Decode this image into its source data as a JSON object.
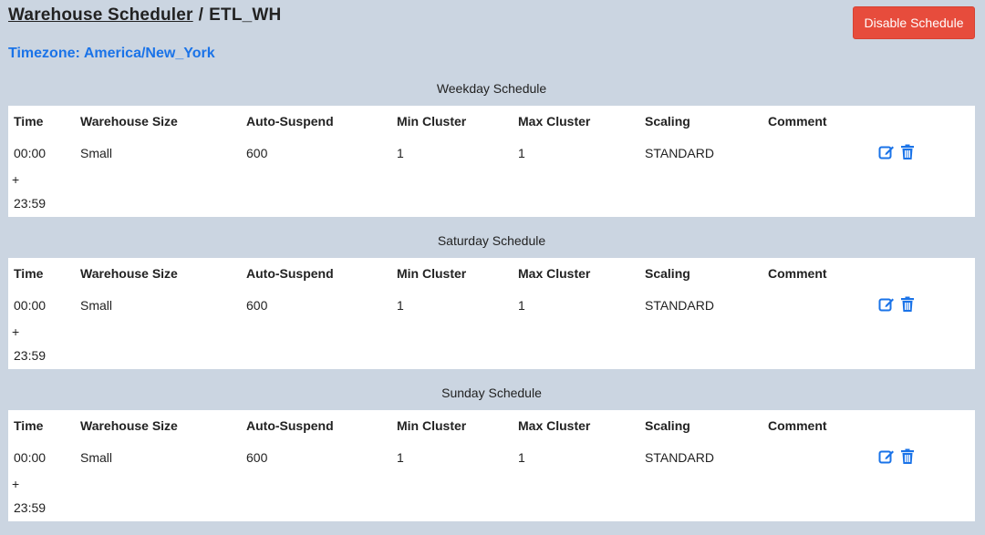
{
  "header": {
    "breadcrumb_root": "Warehouse Scheduler",
    "separator": "/",
    "current": "ETL_WH"
  },
  "actions": {
    "disable_label": "Disable Schedule"
  },
  "timezone": {
    "label": "Timezone:",
    "value": "America/New_York"
  },
  "columns": {
    "time": "Time",
    "size": "Warehouse Size",
    "suspend": "Auto-Suspend",
    "min": "Min Cluster",
    "max": "Max Cluster",
    "scaling": "Scaling",
    "comment": "Comment"
  },
  "schedules": [
    {
      "title": "Weekday Schedule",
      "row": {
        "start": "00:00",
        "plus": "+",
        "end": "23:59",
        "size": "Small",
        "suspend": "600",
        "min": "1",
        "max": "1",
        "scaling": "STANDARD",
        "comment": ""
      }
    },
    {
      "title": "Saturday Schedule",
      "row": {
        "start": "00:00",
        "plus": "+",
        "end": "23:59",
        "size": "Small",
        "suspend": "600",
        "min": "1",
        "max": "1",
        "scaling": "STANDARD",
        "comment": ""
      }
    },
    {
      "title": "Sunday Schedule",
      "row": {
        "start": "00:00",
        "plus": "+",
        "end": "23:59",
        "size": "Small",
        "suspend": "600",
        "min": "1",
        "max": "1",
        "scaling": "STANDARD",
        "comment": ""
      }
    }
  ],
  "colors": {
    "background": "#cbd5e1",
    "accent": "#1a73e8",
    "danger": "#e74c3c"
  },
  "icons": {
    "edit": "edit-icon",
    "delete": "trash-icon"
  }
}
